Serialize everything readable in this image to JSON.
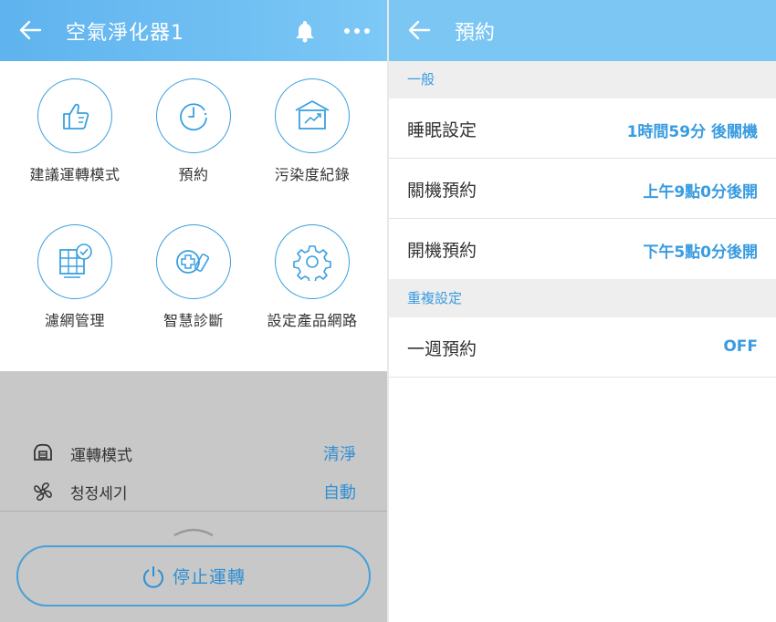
{
  "left": {
    "header": {
      "title": "空氣淨化器1",
      "back_icon": "arrow-left-icon",
      "bell_icon": "bell-icon",
      "more_icon": "more-icon"
    },
    "menu": [
      {
        "label": "建議運轉模式",
        "icon": "thumbs-up-icon"
      },
      {
        "label": "預約",
        "icon": "clock-icon"
      },
      {
        "label": "污染度紀錄",
        "icon": "chart-house-icon"
      },
      {
        "label": "濾網管理",
        "icon": "filter-check-icon"
      },
      {
        "label": "智慧診斷",
        "icon": "smart-diagnosis-icon"
      },
      {
        "label": "設定產品網路",
        "icon": "gear-icon"
      }
    ],
    "status": [
      {
        "label": "運轉模式",
        "value": "清淨",
        "icon": "mode-icon"
      },
      {
        "label": "청정세기",
        "value": "自動",
        "icon": "fan-icon"
      }
    ],
    "stop_button": {
      "label": "停止運轉",
      "icon": "power-icon"
    }
  },
  "right": {
    "header": {
      "title": "預約",
      "back_icon": "arrow-left-icon"
    },
    "sections": [
      {
        "title": "一般",
        "rows": [
          {
            "label": "睡眠設定",
            "value": "1時間59分 後關機"
          },
          {
            "label": "關機預約",
            "value": "上午9點0分後開"
          },
          {
            "label": "開機預約",
            "value": "下午5點0分後開"
          }
        ]
      },
      {
        "title": "重複設定",
        "rows": [
          {
            "label": "一週預約",
            "value": "OFF"
          }
        ]
      }
    ]
  },
  "colors": {
    "accent": "#3aa0e0",
    "header": "#7cc6f4"
  }
}
